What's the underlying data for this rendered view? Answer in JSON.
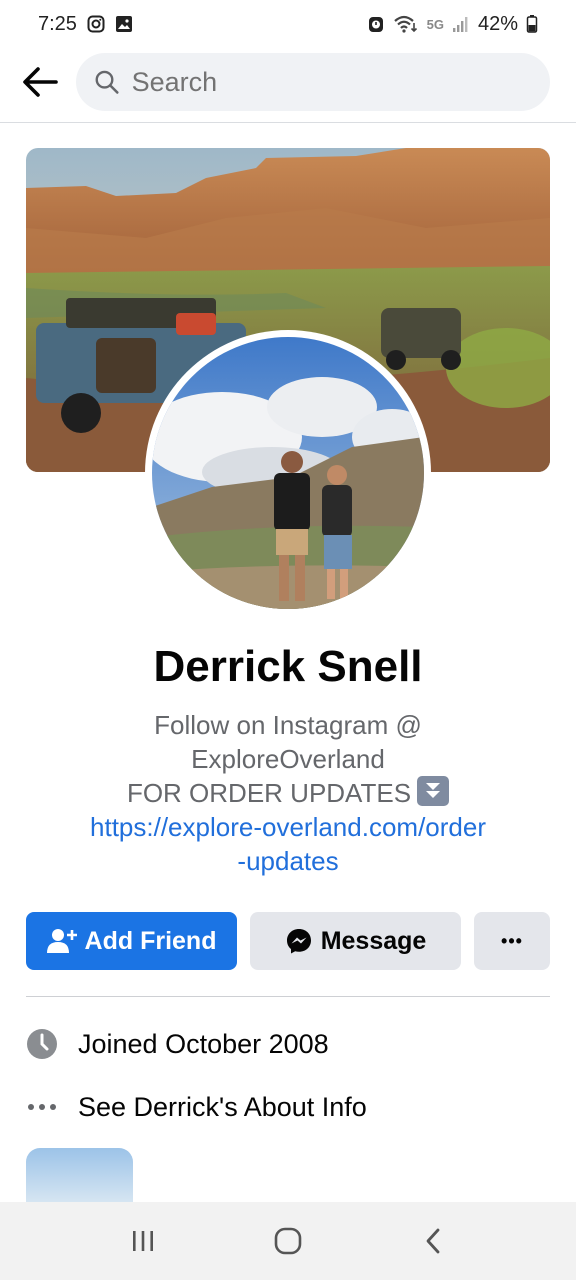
{
  "status_bar": {
    "time": "7:25",
    "network": "5G",
    "battery": "42%",
    "icons": [
      "instagram-icon",
      "gallery-icon",
      "alarm-icon",
      "wifi-icon",
      "signal-icon",
      "battery-icon"
    ]
  },
  "app_bar": {
    "back_icon": "arrow-left-icon",
    "search_placeholder": "Search"
  },
  "profile": {
    "name": "Derrick Snell",
    "bio_lines": [
      "Follow on Instagram @",
      "ExploreOverland",
      "FOR ORDER UPDATES"
    ],
    "bio_emoji": "double-down-arrow-emoji",
    "link_lines": [
      "https://explore-overland.com/order",
      "-updates"
    ]
  },
  "actions": {
    "add_friend_label": "Add Friend",
    "message_label": "Message",
    "more_label": "•••"
  },
  "info": {
    "joined": "Joined October 2008",
    "about": "See Derrick's About Info"
  },
  "colors": {
    "accent": "#1b74e4",
    "link": "#216fdb",
    "button_gray": "#e4e6eb",
    "secondary_text": "#65676b"
  },
  "nav_bar": {
    "icons": [
      "recent-apps-icon",
      "home-icon",
      "back-icon"
    ]
  }
}
